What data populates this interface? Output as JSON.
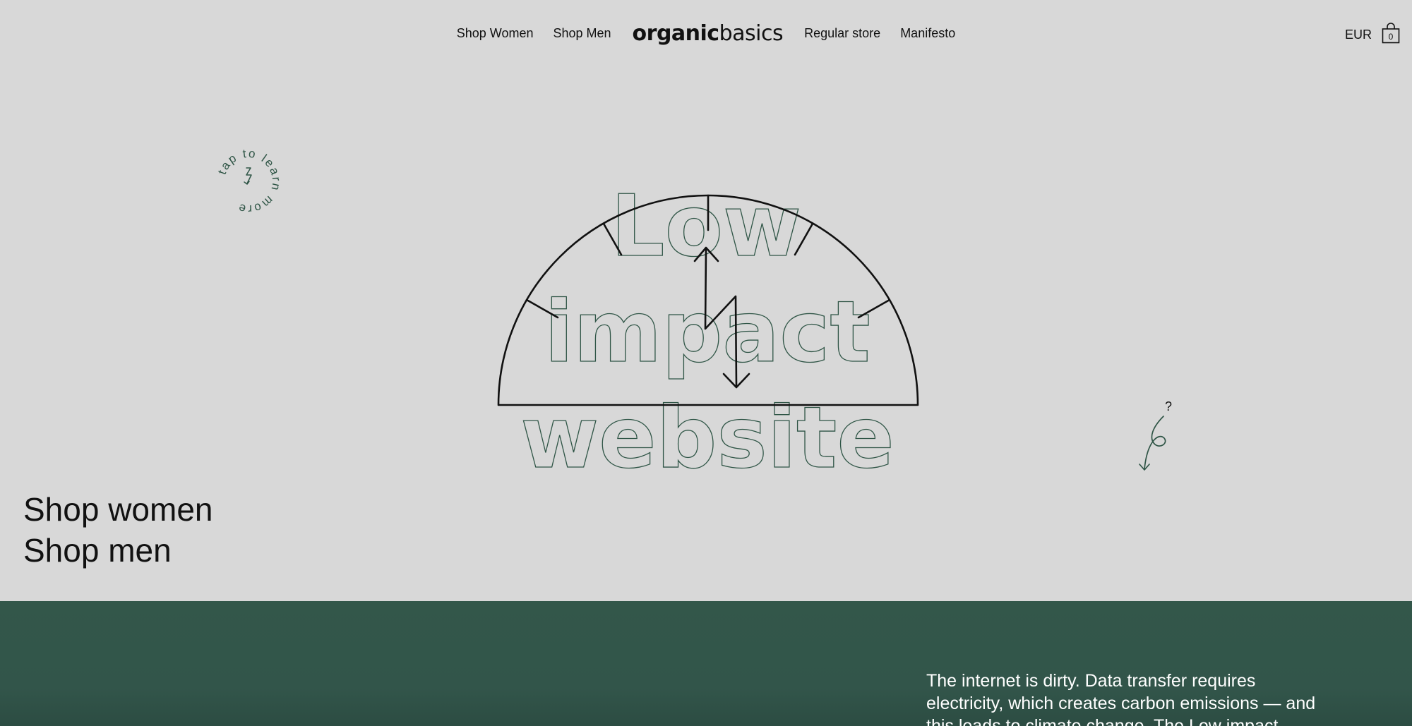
{
  "header": {
    "nav_left": [
      "Shop Women",
      "Shop Men"
    ],
    "logo_bold": "organic",
    "logo_light": "basics",
    "nav_right": [
      "Regular store",
      "Manifesto"
    ],
    "currency": "EUR",
    "cart_count": "0"
  },
  "hero": {
    "headline_lines": [
      "Low",
      "impact",
      "website"
    ],
    "badge_text": "tap to learn more",
    "squiggle_mark": "?"
  },
  "shop_links": {
    "women": "Shop women",
    "men": "Shop men"
  },
  "intro": {
    "text": "The internet is dirty. Data transfer requires electricity, which creates carbon emissions — and this leads to climate change. The Low impact website makes this transfer less"
  },
  "colors": {
    "background": "#d8d8d8",
    "accent_green": "#33574a",
    "outline_green": "#2f5546",
    "text": "#111111"
  }
}
